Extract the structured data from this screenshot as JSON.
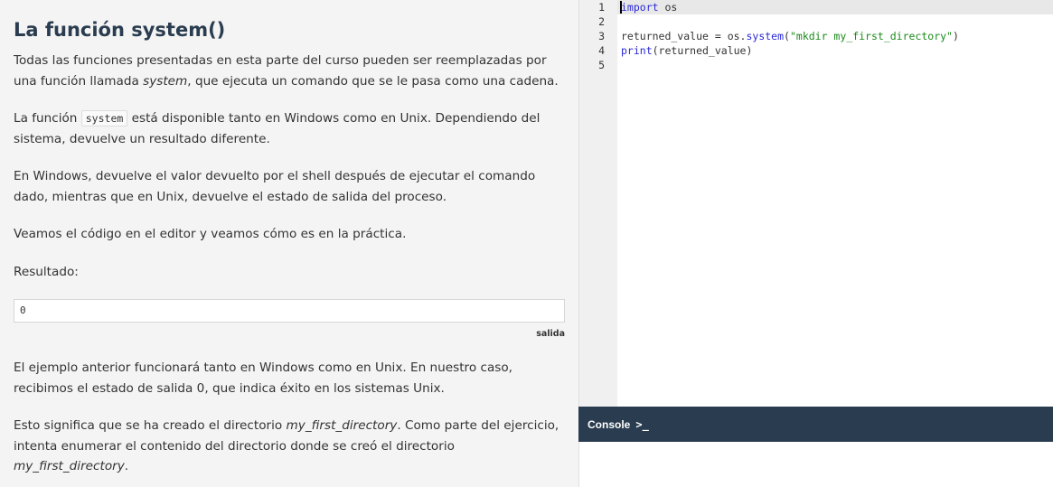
{
  "lesson": {
    "title": "La función system()",
    "p1_a": "Todas las funciones presentadas en esta parte del curso pueden ser reemplazadas por una función llamada ",
    "p1_em": "system",
    "p1_b": ", que ejecuta un comando que se le pasa como una cadena.",
    "p2_a": "La función ",
    "p2_code": "system",
    "p2_b": " está disponible tanto en Windows como en Unix. Dependiendo del sistema, devuelve un resultado diferente.",
    "p3": "En Windows, devuelve el valor devuelto por el shell después de ejecutar el comando dado, mientras que en Unix, devuelve el estado de salida del proceso.",
    "p4": "Veamos el código en el editor y veamos cómo es en la práctica.",
    "p5": "Resultado:",
    "output_value": "0",
    "output_label": "salida",
    "p6": "El ejemplo anterior funcionará tanto en Windows como en Unix. En nuestro caso, recibimos el estado de salida 0, que indica éxito en los sistemas Unix.",
    "p7_a": "Esto significa que se ha creado el directorio ",
    "p7_em1": "my_first_directory",
    "p7_b": ". Como parte del ejercicio, intenta enumerar el contenido del directorio donde se creó el directorio ",
    "p7_em2": "my_first_directory",
    "p7_c": "."
  },
  "editor": {
    "line_numbers": [
      "1",
      "2",
      "3",
      "4",
      "5"
    ],
    "line1": {
      "kw": "import",
      "rest": " os"
    },
    "line3": {
      "a": "returned_value = os.",
      "fn": "system",
      "b": "(",
      "str": "\"mkdir my_first_directory\"",
      "c": ")"
    },
    "line4": {
      "kw": "print",
      "rest": "(returned_value)"
    }
  },
  "console": {
    "label": "Console",
    "icon": "terminal-prompt-icon",
    "icon_glyph": ">_"
  },
  "colors": {
    "title": "#2a3c4f",
    "console_bar": "#2a3c4f",
    "keyword": "#2a2ad6",
    "string": "#1a8a1a",
    "lesson_bg": "#f4f4f4"
  }
}
